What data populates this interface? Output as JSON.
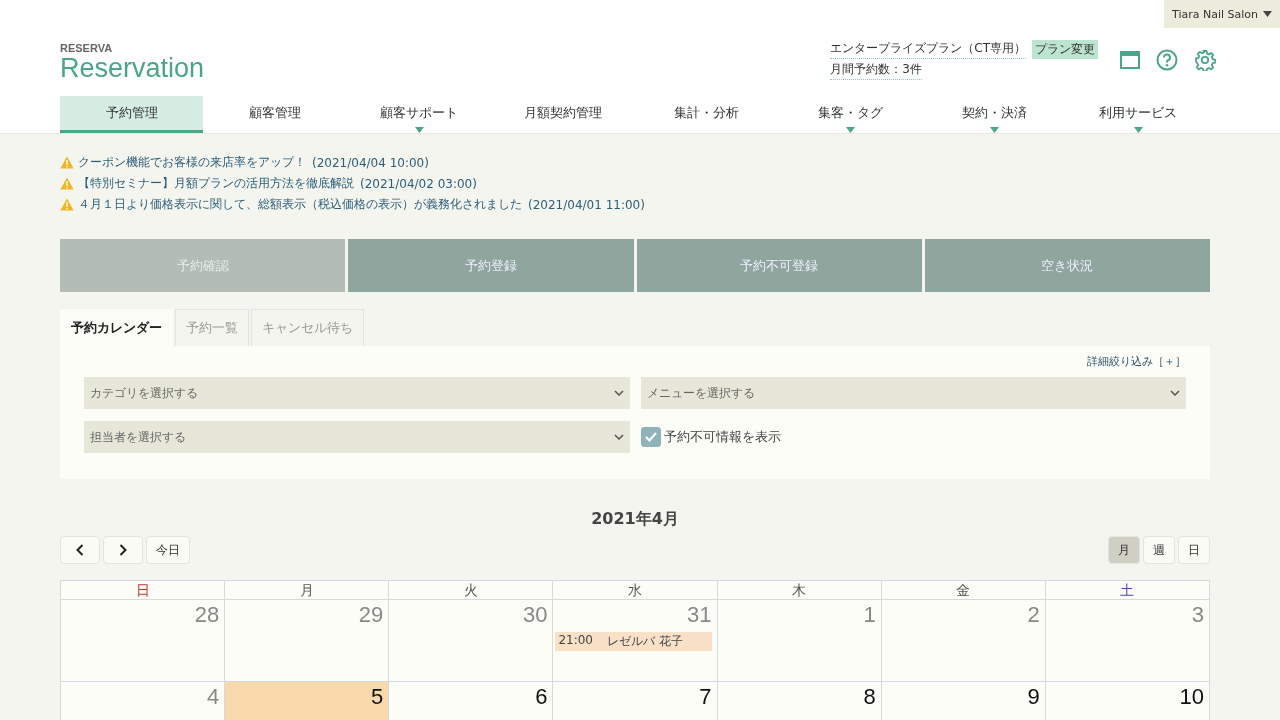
{
  "account": {
    "name": "Tiara Nail Salon"
  },
  "logo": {
    "brand": "RESERVA",
    "product": "Reservation"
  },
  "plan": {
    "name": "エンタープライズプラン（CT専用）",
    "change_button": "プラン変更",
    "monthly_count": "月間予約数：3件"
  },
  "nav": [
    {
      "label": "予約管理",
      "selected": true,
      "dropdown": false
    },
    {
      "label": "顧客管理",
      "selected": false,
      "dropdown": false
    },
    {
      "label": "顧客サポート",
      "selected": false,
      "dropdown": true
    },
    {
      "label": "月額契約管理",
      "selected": false,
      "dropdown": false
    },
    {
      "label": "集計・分析",
      "selected": false,
      "dropdown": false
    },
    {
      "label": "集客・タグ",
      "selected": false,
      "dropdown": true
    },
    {
      "label": "契約・決済",
      "selected": false,
      "dropdown": true
    },
    {
      "label": "利用サービス",
      "selected": false,
      "dropdown": true
    }
  ],
  "notices": [
    {
      "title": "クーポン機能でお客様の来店率をアップ！",
      "date": "(2021/04/04 10:00)"
    },
    {
      "title": "【特別セミナー】月額プランの活用方法を徹底解説",
      "date": "(2021/04/02 03:00)"
    },
    {
      "title": "４月１日より価格表示に関して、総額表示（税込価格の表示）が義務化されました",
      "date": "(2021/04/01 11:00)"
    }
  ],
  "actions": [
    {
      "label": "予約確認",
      "selected": true
    },
    {
      "label": "予約登録",
      "selected": false
    },
    {
      "label": "予約不可登録",
      "selected": false
    },
    {
      "label": "空き状況",
      "selected": false
    }
  ],
  "tabs": [
    {
      "label": "予約カレンダー",
      "selected": true
    },
    {
      "label": "予約一覧",
      "selected": false
    },
    {
      "label": "キャンセル待ち",
      "selected": false
    }
  ],
  "filters": {
    "advanced_link": "詳細絞り込み［＋］",
    "selects": [
      {
        "placeholder": "カテゴリを選択する"
      },
      {
        "placeholder": "メニューを選択する"
      },
      {
        "placeholder": "担当者を選択する"
      }
    ],
    "show_unavailable": {
      "label": "予約不可情報を表示",
      "checked": true
    }
  },
  "calendar": {
    "title": "2021年4月",
    "today_button": "今日",
    "views": [
      {
        "label": "月",
        "selected": true
      },
      {
        "label": "週",
        "selected": false
      },
      {
        "label": "日",
        "selected": false
      }
    ],
    "weekdays": [
      {
        "label": "日",
        "color": "#c0392b"
      },
      {
        "label": "月"
      },
      {
        "label": "火"
      },
      {
        "label": "水"
      },
      {
        "label": "木"
      },
      {
        "label": "金"
      },
      {
        "label": "土",
        "color": "#5b3fa8"
      }
    ],
    "weeks": [
      [
        {
          "day": "28",
          "today": false,
          "past": true
        },
        {
          "day": "29",
          "today": false,
          "past": true
        },
        {
          "day": "30",
          "today": false,
          "past": true
        },
        {
          "day": "31",
          "today": false,
          "past": true,
          "events": [
            {
              "time": "21:00",
              "name": "レゼルバ 花子"
            }
          ]
        },
        {
          "day": "1",
          "today": false,
          "past": true
        },
        {
          "day": "2",
          "today": false,
          "past": true
        },
        {
          "day": "3",
          "today": false,
          "past": true
        }
      ],
      [
        {
          "day": "4",
          "today": false,
          "past": true
        },
        {
          "day": "5",
          "today": true,
          "past": false
        },
        {
          "day": "6",
          "today": false,
          "past": false
        },
        {
          "day": "7",
          "today": false,
          "past": false
        },
        {
          "day": "8",
          "today": false,
          "past": false
        },
        {
          "day": "9",
          "today": false,
          "past": false
        },
        {
          "day": "10",
          "today": false,
          "past": false
        }
      ]
    ]
  }
}
